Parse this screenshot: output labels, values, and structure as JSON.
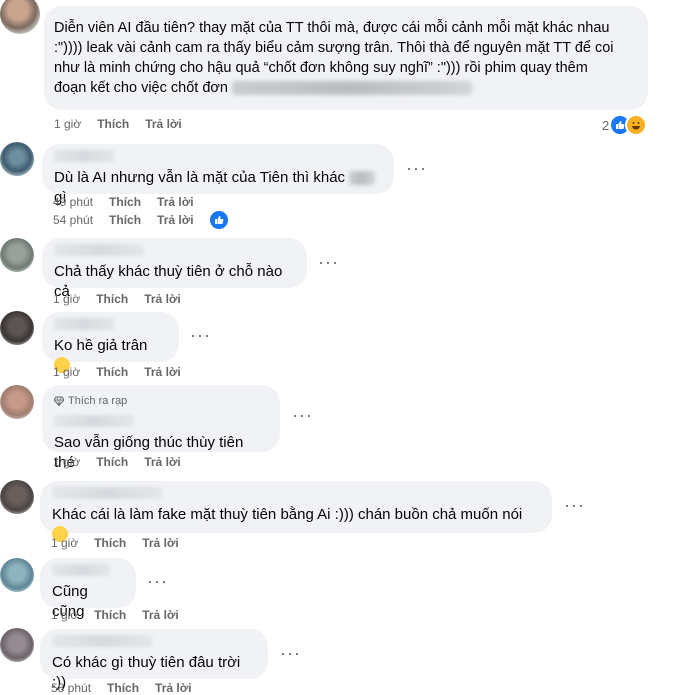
{
  "comments": [
    {
      "text_line1": "Diễn viên AI đầu tiên? thay mặt của TT thôi mà, được cái mỗi cảnh mỗi mặt khác nhau",
      "text_line2": ":\")))) leak vài cảnh cam ra thấy biểu cảm sượng trân. Thôi thà để nguyên mặt TT để coi",
      "text_line3": "như là minh chứng cho hậu quả “chốt đơn không suy nghĩ” :\"))) rồi phim quay thêm",
      "text_line4": "đoạn kết cho việc chốt đơn",
      "time": "1 giờ",
      "like": "Thích",
      "reply": "Trả lời",
      "reaction_count": "2"
    },
    {
      "text": "Dù là AI nhưng vẫn là mặt của Tiên thì khác",
      "text_tail": "gì",
      "time": "49 phút",
      "like": "Thích",
      "reply": "Trả lời",
      "time2": "54 phút",
      "like2": "Thích",
      "reply2": "Trả lời"
    },
    {
      "text": "Chả thấy khác thuỳ tiên ở chỗ nào cả",
      "time": "1 giờ",
      "like": "Thích",
      "reply": "Trả lời"
    },
    {
      "text": "Ko hề giả trân",
      "time": "1 giờ",
      "like": "Thích",
      "reply": "Trả lời"
    },
    {
      "badge": "Thích ra rạp",
      "text": "Sao vẫn giống thúc thùy tiên thé",
      "time": "1 giờ",
      "like": "Thích",
      "reply": "Trả lời"
    },
    {
      "text": "Khác cái là làm fake mặt thuỳ tiên bằng Ai :))) chán buồn chả muốn nói",
      "time": "1 giờ",
      "like": "Thích",
      "reply": "Trả lời"
    },
    {
      "text": "Cũng cũng",
      "time": "1 giờ",
      "like": "Thích",
      "reply": "Trả lời"
    },
    {
      "text": "Có khác gì thuỳ tiên đâu trời :))",
      "time": "58 phút",
      "like": "Thích",
      "reply": "Trả lời"
    }
  ],
  "more_label": "···"
}
